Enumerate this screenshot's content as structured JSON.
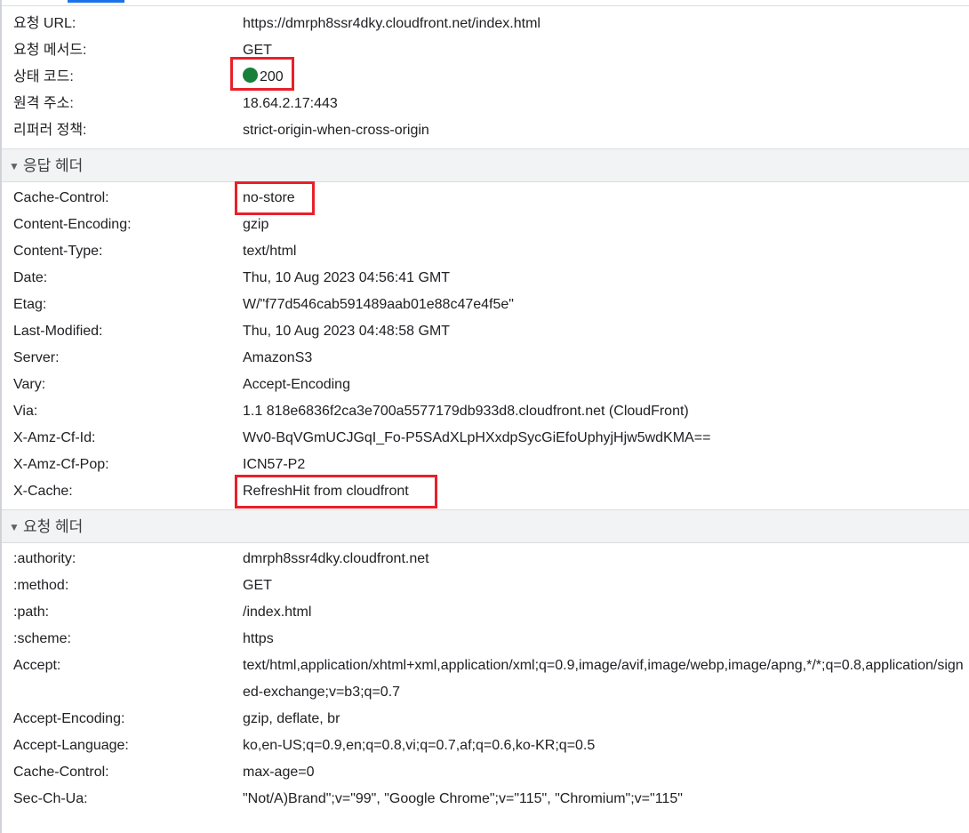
{
  "general": [
    {
      "key": "요청 URL:",
      "value": "https://dmrph8ssr4dky.cloudfront.net/index.html"
    },
    {
      "key": "요청 메서드:",
      "value": "GET"
    },
    {
      "key": "상태 코드:",
      "value": "200",
      "status_color": "#188038"
    },
    {
      "key": "원격 주소:",
      "value": "18.64.2.17:443"
    },
    {
      "key": "리퍼러 정책:",
      "value": "strict-origin-when-cross-origin"
    }
  ],
  "response_headers": {
    "title": "응답 헤더",
    "rows": [
      {
        "key": "Cache-Control:",
        "value": "no-store"
      },
      {
        "key": "Content-Encoding:",
        "value": "gzip"
      },
      {
        "key": "Content-Type:",
        "value": "text/html"
      },
      {
        "key": "Date:",
        "value": "Thu, 10 Aug 2023 04:56:41 GMT"
      },
      {
        "key": "Etag:",
        "value": "W/\"f77d546cab591489aab01e88c47e4f5e\""
      },
      {
        "key": "Last-Modified:",
        "value": "Thu, 10 Aug 2023 04:48:58 GMT"
      },
      {
        "key": "Server:",
        "value": "AmazonS3"
      },
      {
        "key": "Vary:",
        "value": "Accept-Encoding"
      },
      {
        "key": "Via:",
        "value": "1.1 818e6836f2ca3e700a5577179db933d8.cloudfront.net (CloudFront)"
      },
      {
        "key": "X-Amz-Cf-Id:",
        "value": "Wv0-BqVGmUCJGqI_Fo-P5SAdXLpHXxdpSycGiEfoUphyjHjw5wdKMA=="
      },
      {
        "key": "X-Amz-Cf-Pop:",
        "value": "ICN57-P2"
      },
      {
        "key": "X-Cache:",
        "value": "RefreshHit from cloudfront"
      }
    ]
  },
  "request_headers": {
    "title": "요청 헤더",
    "rows": [
      {
        "key": ":authority:",
        "value": "dmrph8ssr4dky.cloudfront.net"
      },
      {
        "key": ":method:",
        "value": "GET"
      },
      {
        "key": ":path:",
        "value": "/index.html"
      },
      {
        "key": ":scheme:",
        "value": "https"
      },
      {
        "key": "Accept:",
        "value": "text/html,application/xhtml+xml,application/xml;q=0.9,image/avif,image/webp,image/apng,*/*;q=0.8,application/signed-exchange;v=b3;q=0.7"
      },
      {
        "key": "Accept-Encoding:",
        "value": "gzip, deflate, br"
      },
      {
        "key": "Accept-Language:",
        "value": "ko,en-US;q=0.9,en;q=0.8,vi;q=0.7,af;q=0.6,ko-KR;q=0.5"
      },
      {
        "key": "Cache-Control:",
        "value": "max-age=0"
      },
      {
        "key": "Sec-Ch-Ua:",
        "value": "\"Not/A)Brand\";v=\"99\", \"Google Chrome\";v=\"115\", \"Chromium\";v=\"115\""
      }
    ]
  },
  "icons": {
    "section_toggle": "triangle-down-icon",
    "status": "green-circle-icon"
  },
  "annotation_color": "#e8202a"
}
